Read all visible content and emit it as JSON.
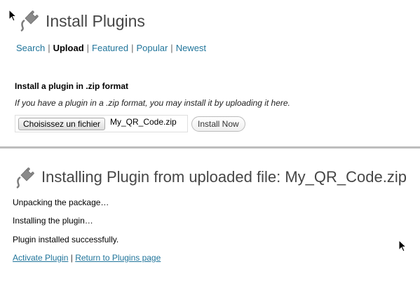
{
  "top": {
    "title": "Install Plugins",
    "subnav": [
      {
        "label": "Search"
      },
      {
        "label": "Upload",
        "current": true
      },
      {
        "label": "Featured"
      },
      {
        "label": "Popular"
      },
      {
        "label": "Newest"
      }
    ],
    "separator": "|",
    "upload": {
      "heading": "Install a plugin in .zip format",
      "description": "If you have a plugin in a .zip format, you may install it by uploading it here.",
      "choose_label": "Choisissez un fichier",
      "file_name": "My_QR_Code.zip",
      "install_label": "Install Now"
    }
  },
  "bottom": {
    "title": "Installing Plugin from uploaded file: My_QR_Code.zip",
    "steps": [
      "Unpacking the package…",
      "Installing the plugin…",
      "Plugin installed successfully."
    ],
    "actions": {
      "activate_label": "Activate Plugin",
      "separator": "|",
      "return_label": "Return to Plugins page"
    }
  },
  "icons": {
    "plugin": "plug-icon",
    "cursor": "mouse-pointer-icon"
  },
  "colors": {
    "link": "#21759b",
    "heading": "#464646",
    "divider": "#bdbdbd"
  }
}
